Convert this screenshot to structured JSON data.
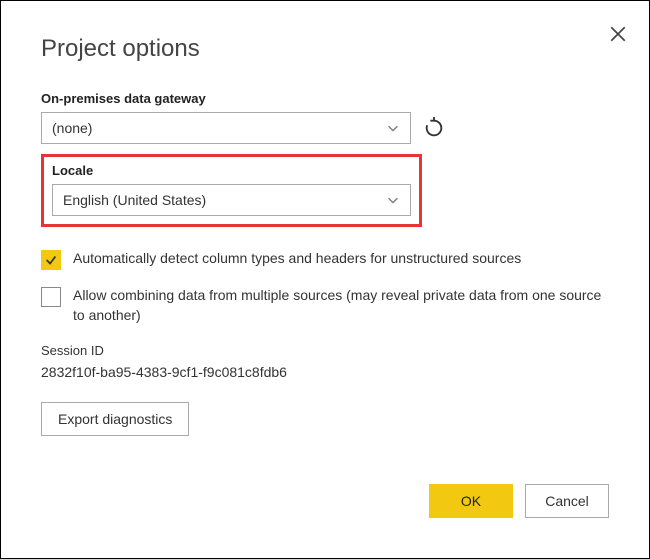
{
  "dialog": {
    "title": "Project options",
    "gateway": {
      "label": "On-premises data gateway",
      "value": "(none)"
    },
    "locale": {
      "label": "Locale",
      "value": "English (United States)"
    },
    "checkbox_detect": {
      "checked": true,
      "label": "Automatically detect column types and headers for unstructured sources"
    },
    "checkbox_combine": {
      "checked": false,
      "label": "Allow combining data from multiple sources (may reveal private data from one source to another)"
    },
    "session": {
      "label": "Session ID",
      "value": "2832f10f-ba95-4383-9cf1-f9c081c8fdb6"
    },
    "export_button": "Export diagnostics",
    "ok": "OK",
    "cancel": "Cancel"
  }
}
